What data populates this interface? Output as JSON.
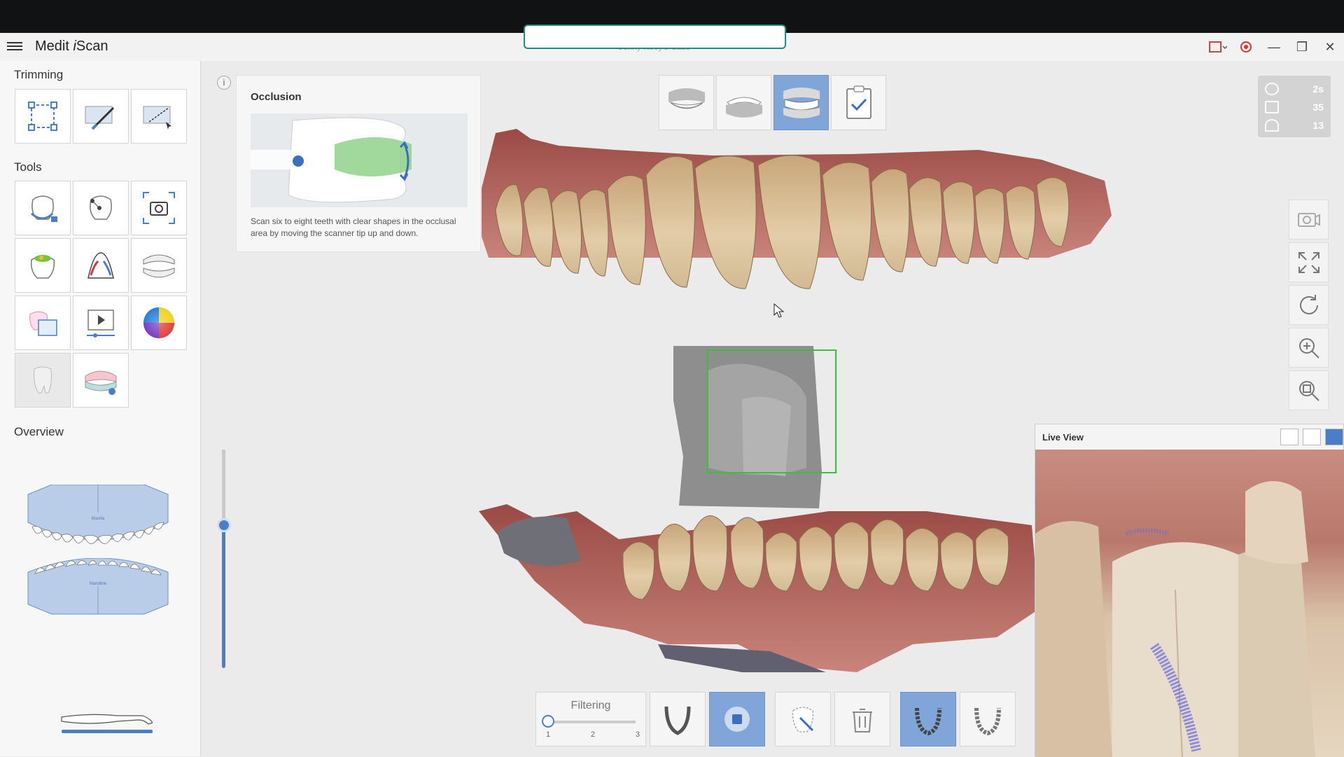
{
  "app": {
    "title_main": "Medit ",
    "title_italic": "i",
    "title_rest": "Scan",
    "case_name": "Jenny Kooy's Case"
  },
  "top_input": {
    "value": "",
    "placeholder": ""
  },
  "sidebar": {
    "trimming_label": "Trimming",
    "tools_label": "Tools",
    "overview_label": "Overview",
    "overview_upper_label": "Maxilla",
    "overview_lower_label": "Mandible"
  },
  "guide": {
    "title": "Occlusion",
    "description": "Scan six to eight teeth with clear shapes in the occlusal area by moving the scanner tip up and down."
  },
  "stats": [
    {
      "icon": "timer-icon",
      "value": "2s"
    },
    {
      "icon": "shots-icon",
      "value": "35"
    },
    {
      "icon": "rotation-icon",
      "value": "13"
    }
  ],
  "live_view": {
    "title": "Live View"
  },
  "filter": {
    "label": "Filtering",
    "levels": [
      "1",
      "2",
      "3"
    ],
    "selected": 1
  },
  "colors": {
    "accent": "#4a7fc8",
    "active_tab": "#7fa5d9",
    "record": "#dd3333",
    "scan_frame": "#36c23a"
  },
  "info_glyph": "i"
}
